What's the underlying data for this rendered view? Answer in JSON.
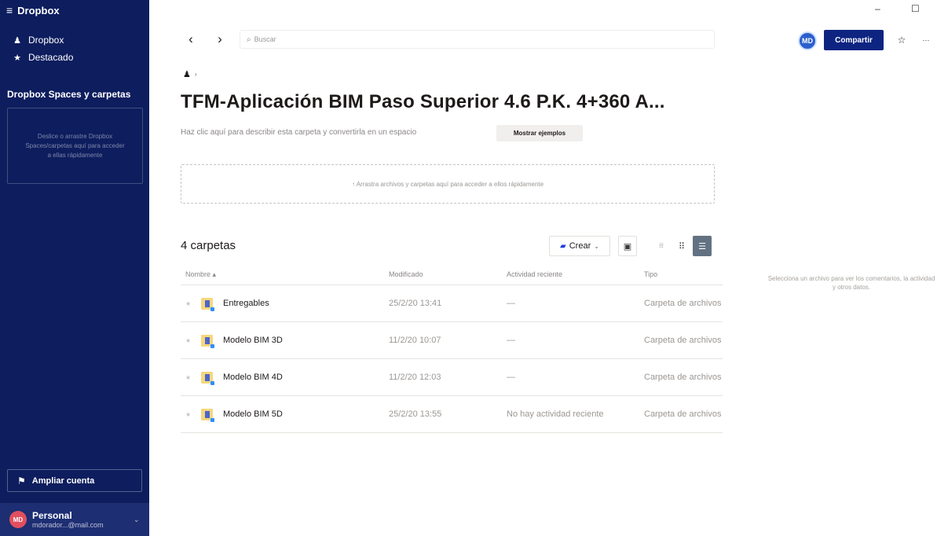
{
  "app": {
    "title": "Dropbox",
    "menu_glyph": "≡"
  },
  "sidebar": {
    "items": [
      {
        "label": "Dropbox",
        "icon": "user-icon",
        "glyph": "♟"
      },
      {
        "label": "Destacado",
        "icon": "star-icon",
        "glyph": "★"
      }
    ],
    "section_title": "Dropbox Spaces y carpetas",
    "drop_hint": "Deslice o arrastre Dropbox Spaces/carpetas aquí para acceder a ellas rápidamente",
    "upgrade_label": "Ampliar cuenta",
    "upgrade_glyph": "⚑",
    "account": {
      "avatar": "MD",
      "name": "Personal",
      "email": "mdorador...@mail.com",
      "chevron": "⌄"
    }
  },
  "topbar": {
    "back_glyph": "‹",
    "forward_glyph": "›",
    "search_glyph": "⌕",
    "search_placeholder": "Buscar",
    "avatar": "MD",
    "share_label": "Compartir",
    "star_glyph": "☆",
    "more_glyph": "···",
    "window": {
      "minimize": "–",
      "maximize": "☐"
    }
  },
  "header": {
    "crumb_icon": "♟",
    "crumb_arrow": "›",
    "title": "TFM-Aplicación BIM Paso Superior 4.6 P.K. 4+360 A...",
    "description": "Haz clic aquí para describir esta carpeta y convertirla en un espacio",
    "examples_label": "Mostrar ejemplos"
  },
  "dropzone": {
    "text": "↑ Arrastra archivos y carpetas aquí para acceder a ellos rápidamente"
  },
  "files": {
    "count_label": "4 carpetas",
    "create_label": "Crear",
    "create_chevron": "⌄",
    "create_glyph": "▰",
    "save_glyph": "▣",
    "view_glyphs": {
      "columns": "⦙⦙⦙",
      "grid": "⠿",
      "list": "☰"
    },
    "columns": {
      "name": "Nombre ▴",
      "modified": "Modificado",
      "activity": "Actividad reciente",
      "type": "Tipo"
    },
    "rows": [
      {
        "name": "Entregables",
        "modified": "25/2/20 13:41",
        "activity": "—",
        "type": "Carpeta de archivos"
      },
      {
        "name": "Modelo BIM 3D",
        "modified": "11/2/20 10:07",
        "activity": "—",
        "type": "Carpeta de archivos"
      },
      {
        "name": "Modelo BIM 4D",
        "modified": "11/2/20 12:03",
        "activity": "—",
        "type": "Carpeta de archivos"
      },
      {
        "name": "Modelo BIM 5D",
        "modified": "25/2/20 13:55",
        "activity": "No hay actividad reciente",
        "type": "Carpeta de archivos"
      }
    ]
  },
  "info_panel": {
    "text": "Selecciona un archivo para ver los comentarios, la actividad y otros datos."
  },
  "colors": {
    "sidebar": "#0d1d5e",
    "accent": "#0d2481",
    "folder": "#f5d77e"
  }
}
